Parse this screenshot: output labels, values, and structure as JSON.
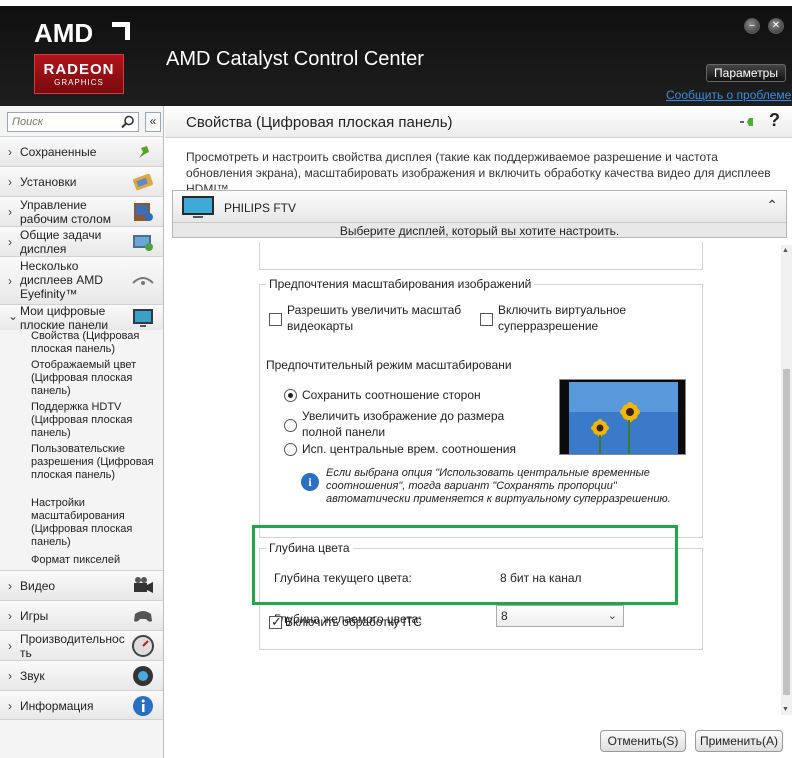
{
  "header": {
    "logo_amd": "AMD",
    "logo_radeon": "RADEON",
    "logo_graphics": "GRAPHICS",
    "app_title": "AMD Catalyst Control Center",
    "minimize": "–",
    "close": "✕",
    "params_label": "Параметры",
    "problem_link": "Сообщить о проблеме"
  },
  "sidebar": {
    "search_placeholder": "Поиск",
    "collapse_label": "«",
    "items": [
      {
        "label": "Сохраненные",
        "icon": "pin-icon",
        "chev": "›"
      },
      {
        "label": "Установки",
        "icon": "presets-icon",
        "chev": "›"
      },
      {
        "label": "Управление рабочим столом",
        "icon": "desktop-management-icon",
        "chev": "›"
      },
      {
        "label": "Общие задачи дисплея",
        "icon": "display-tasks-icon",
        "chev": "›"
      },
      {
        "label": "Несколько дисплеев AMD Eyefinity™",
        "icon": "eyefinity-icon",
        "chev": "›"
      },
      {
        "label": "Мои цифровые плоские панели",
        "icon": "flat-panel-icon",
        "chev": "⌄"
      },
      {
        "label": "Видео",
        "icon": "video-camera-icon",
        "chev": "›"
      },
      {
        "label": "Игры",
        "icon": "gamepad-icon",
        "chev": "›"
      },
      {
        "label": "Производительность",
        "icon": "gauge-icon",
        "chev": "›"
      },
      {
        "label": "Звук",
        "icon": "speaker-icon",
        "chev": "›"
      },
      {
        "label": "Информация",
        "icon": "info-icon",
        "chev": "›"
      }
    ],
    "subitems": [
      "Свойства (Цифровая плоская панель)",
      "Отображаемый цвет (Цифровая плоская панель)",
      "Поддержка HDTV (Цифровая плоская панель)",
      "Пользовательские разрешения (Цифровая плоская панель)",
      "Настройки масштабирования (Цифровая плоская панель)",
      "Формат пикселей"
    ]
  },
  "main": {
    "title": "Свойства (Цифровая плоская панель)",
    "help": "?",
    "description": "Просмотреть и настроить свойства дисплея (такие как поддерживаемое разрешение и частота обновления экрана), масштабировать изображения и включить обработку качества видео для дисплеев HDMI™.",
    "display": {
      "name": "PHILIPS FTV",
      "hint": "Выберите дисплей, который вы хотите настроить.",
      "chevron": "⌃"
    },
    "scaling": {
      "title": "Предпочтения масштабирования изображений",
      "gpu_scaling": "Разрешить увеличить масштаб видеокарты",
      "vsr": "Включить виртуальное суперразрешение",
      "mode_label": "Предпочтительный  режим масштабировани",
      "options": [
        {
          "label": "Сохранить соотношение сторон",
          "checked": true
        },
        {
          "label": "Увеличить изображение до размера полной панели",
          "checked": false
        },
        {
          "label": "Исп. центральные врем. соотношения",
          "checked": false
        }
      ],
      "info": "Если выбрана опция \"Использовать центральные временные соотношения\", тогда вариант \"Сохранять пропорции\" автоматически применяется к виртуальному суперразрешению."
    },
    "color_depth": {
      "title": "Глубина цвета",
      "current_label": "Глубина текущего цвета:",
      "current_value": "8 бит на канал",
      "desired_label": "Глубина желаемого цвета:",
      "desired_value": "8"
    },
    "itc_label": "Включить обработку ITC",
    "cancel_label": "Отменить(S)",
    "apply_label": "Применить(A)"
  }
}
